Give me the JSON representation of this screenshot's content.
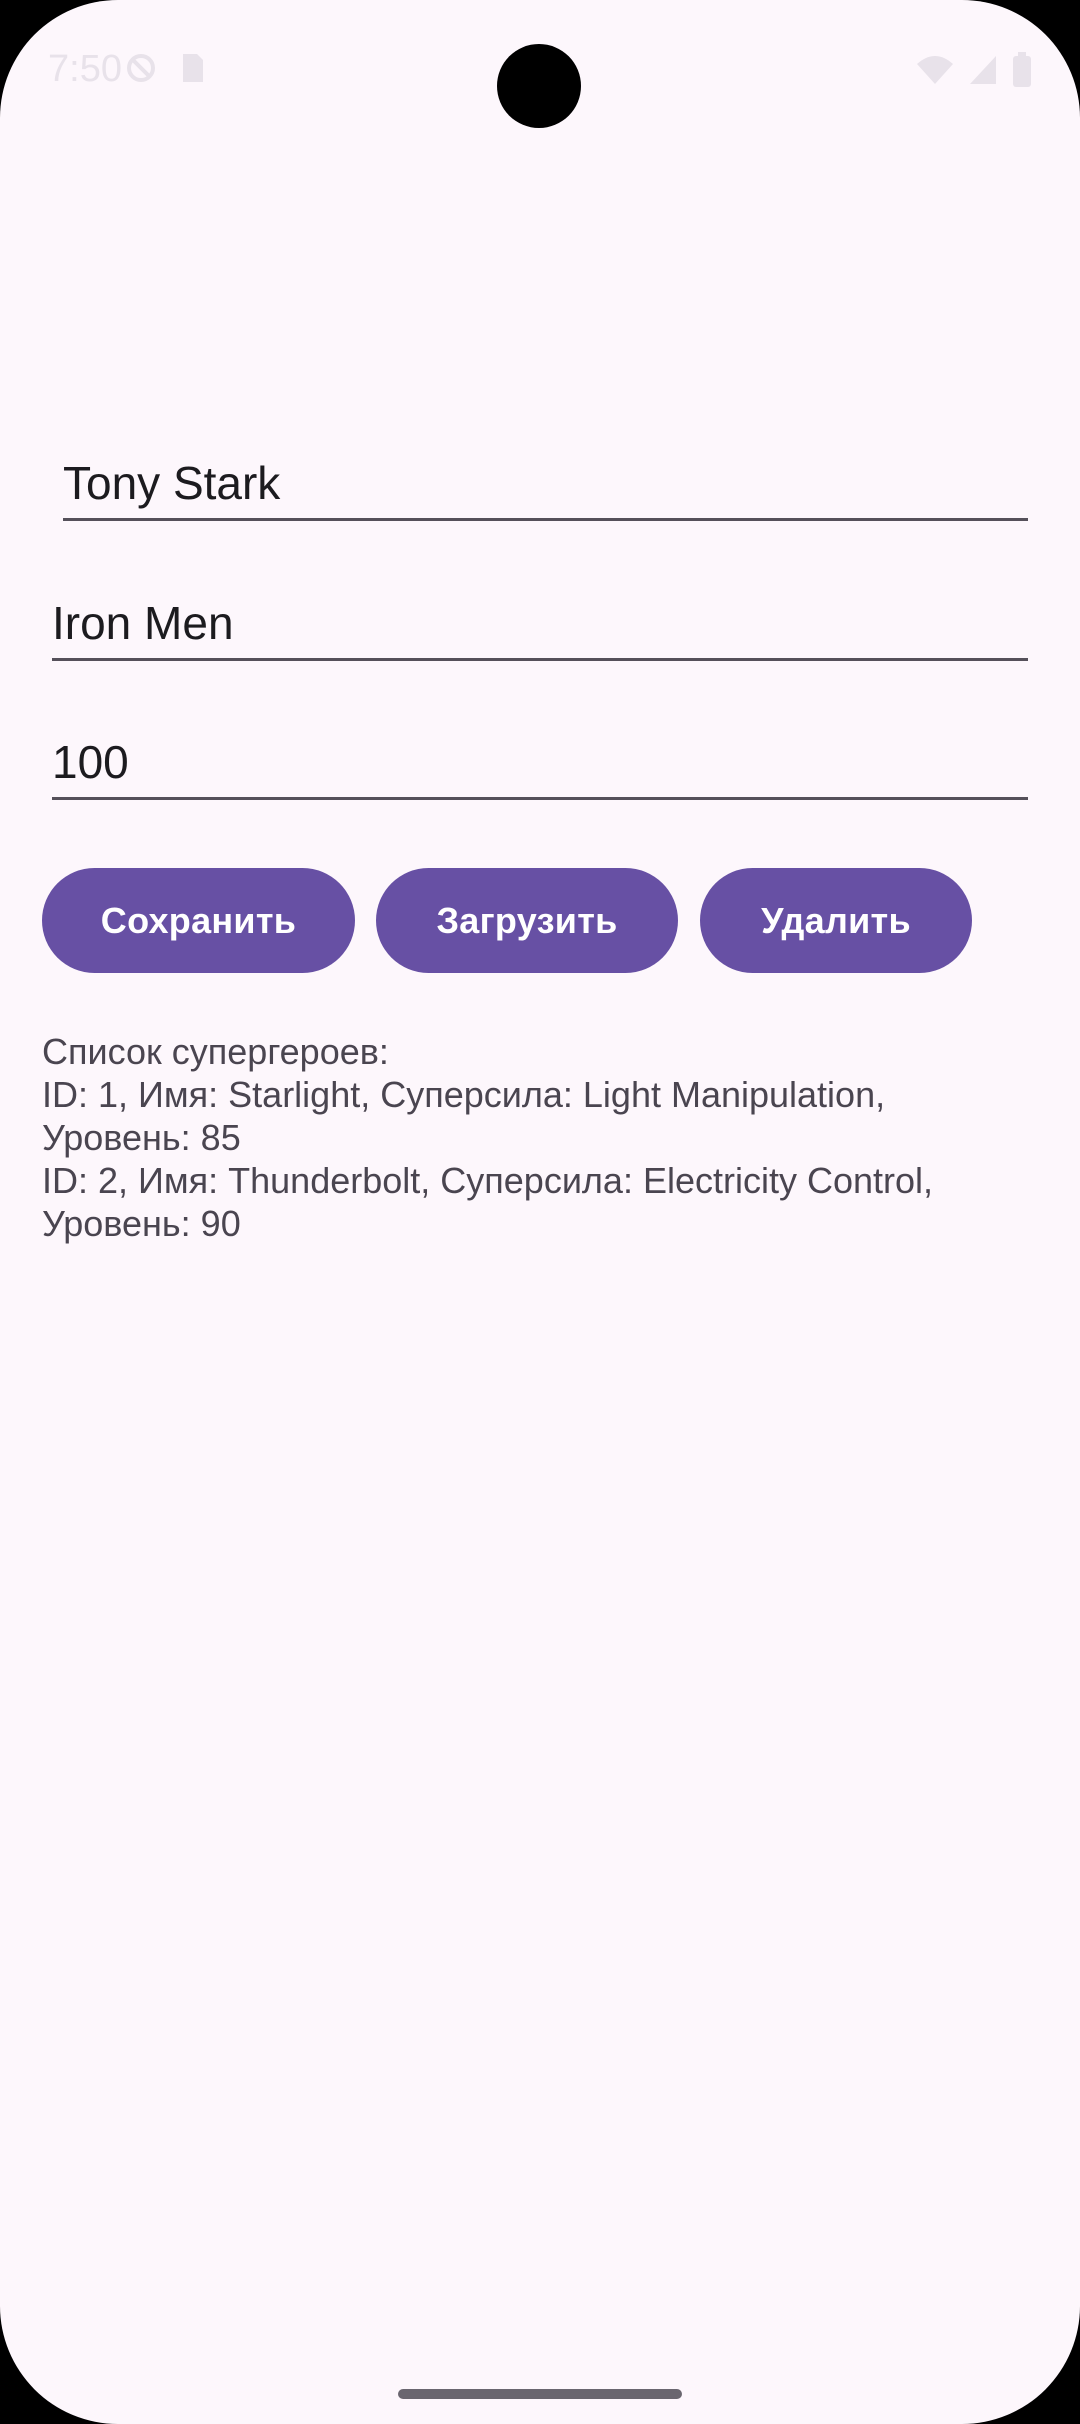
{
  "status_bar": {
    "time": "7:50",
    "icons": [
      "do-not-disturb-icon",
      "sim-card-icon",
      "wifi-icon",
      "signal-icon",
      "battery-icon"
    ]
  },
  "form": {
    "name_value": "Tony Stark",
    "power_value": "Iron Men",
    "level_value": "100"
  },
  "buttons": {
    "save_label": "Сохранить",
    "load_label": "Загрузить",
    "delete_label": "Удалить"
  },
  "list": {
    "title": "Список супергероев:",
    "lines": [
      "ID: 1, Имя: Starlight, Суперсила: Light Manipulation, Уровень: 85",
      "ID: 2, Имя: Thunderbolt, Суперсила: Electricity Control, Уровень: 90"
    ]
  },
  "colors": {
    "background": "#fdf7fc",
    "accent": "#6750a4",
    "text": "#1c1b1f"
  }
}
